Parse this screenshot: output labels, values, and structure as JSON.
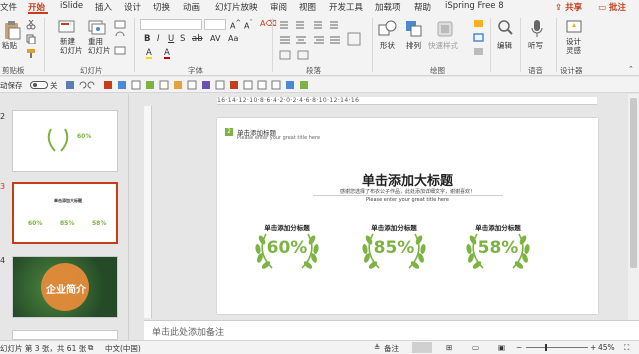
{
  "menu": {
    "tabs": [
      "文件",
      "开始",
      "iSlide",
      "插入",
      "设计",
      "切换",
      "动画",
      "幻灯片放映",
      "审阅",
      "视图",
      "开发工具",
      "加载项",
      "帮助",
      "iSpring Free 8"
    ],
    "share": "共享",
    "comment": "批注"
  },
  "ribbon": {
    "groups": {
      "clipboard": "剪贴板",
      "slides": "幻灯片",
      "font": "字体",
      "paragraph": "段落",
      "drawing": "绘图",
      "voice": "语音",
      "designer": "设计器"
    },
    "paste": "粘贴",
    "new_slide": "新建\n幻灯片",
    "reuse_slide": "重用\n幻灯片",
    "shapes": "形状",
    "arrange": "排列",
    "quick_styles": "快速样式",
    "edit": "编辑",
    "dictate": "听写",
    "design_ideas": "设计\n灵感"
  },
  "qat": {
    "autosave": "动保存",
    "autosave_state": "关"
  },
  "thumbnails": [
    {
      "num": "2",
      "text": "60%"
    },
    {
      "num": "3",
      "title": "单击添加大标题",
      "values": [
        "60%",
        "85%",
        "58%"
      ]
    },
    {
      "num": "4",
      "text": "企业简介"
    }
  ],
  "slide": {
    "section_num": "2",
    "section_title": "单击添加标题",
    "section_subtitle": "Please enter your great title here",
    "main_title": "单击添加大标题",
    "desc_cn": "感谢您选择了布衣公子作品，此处添加详细文字，谢谢喜欢！",
    "desc_en": "Please enter your great title here",
    "stats": [
      {
        "label": "单击添加分标题",
        "value": "60%"
      },
      {
        "label": "单击添加分标题",
        "value": "85%"
      },
      {
        "label": "单击添加分标题",
        "value": "58%"
      }
    ],
    "accent": "#7cb342"
  },
  "ruler_text": "16·14·12·10·8·6·4·2·0·2·4·6·8·10·12·14·16",
  "notes_placeholder": "单击此处添加备注",
  "status": {
    "slide_info": "幻灯片 第 3 张，共 61 张",
    "language": "中文(中国)",
    "notes_btn": "备注",
    "zoom": "45%"
  }
}
